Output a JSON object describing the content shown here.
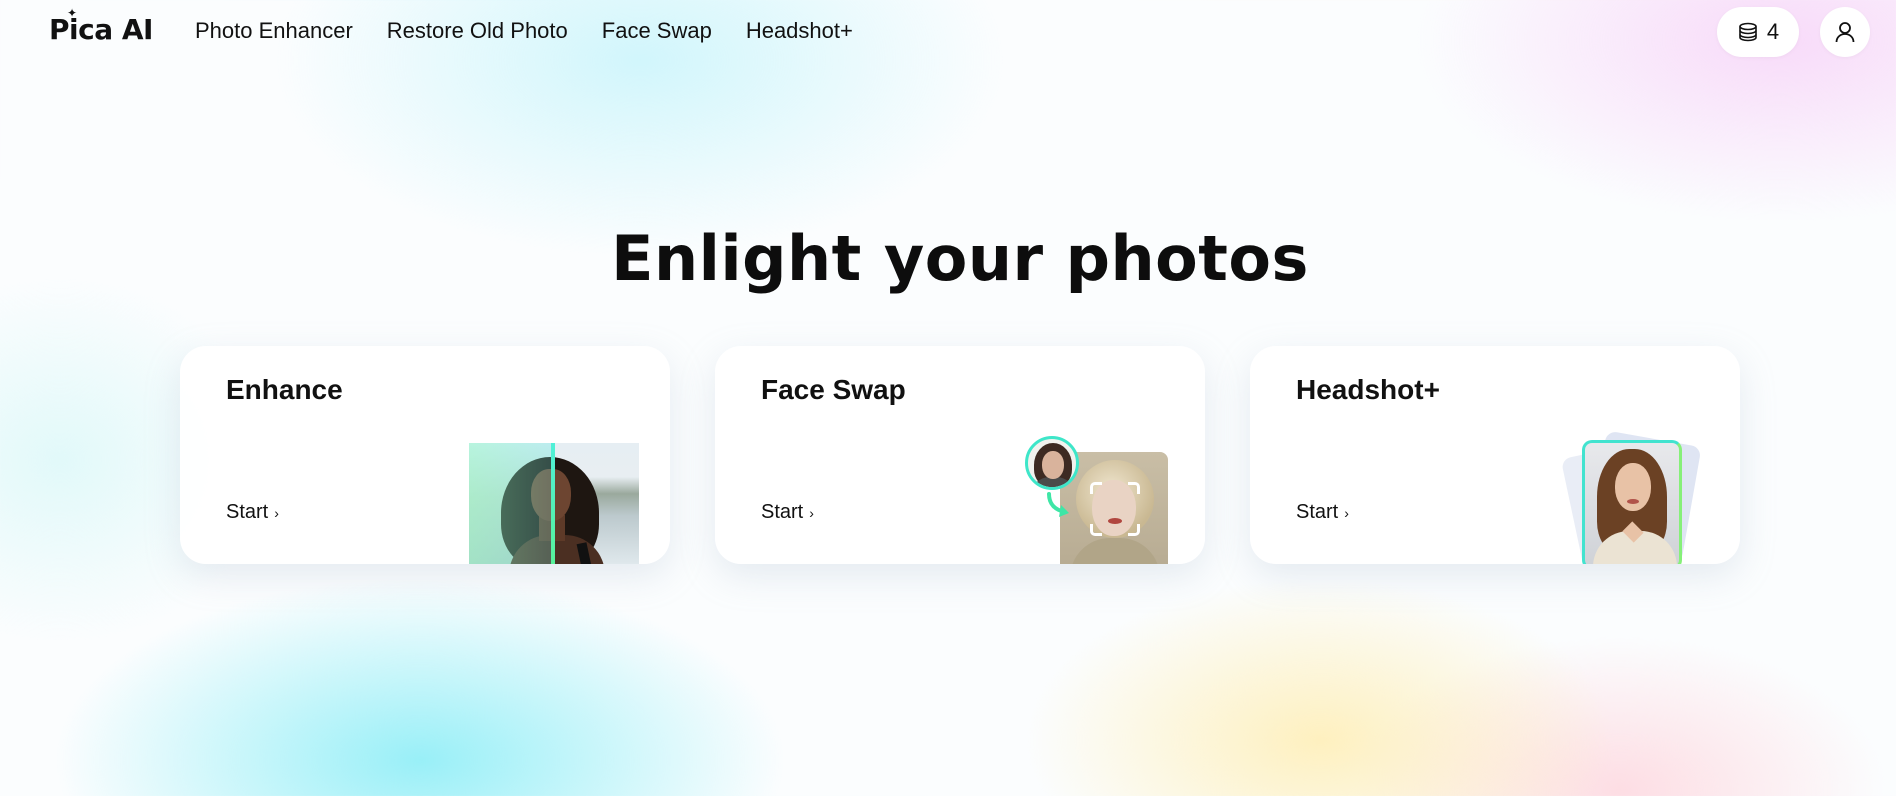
{
  "header": {
    "logo": "Pica AI",
    "nav": [
      "Photo Enhancer",
      "Restore Old Photo",
      "Face Swap",
      "Headshot+"
    ],
    "credits": "4"
  },
  "hero": {
    "title": "Enlight your photos"
  },
  "cards": [
    {
      "title": "Enhance",
      "start": "Start"
    },
    {
      "title": "Face Swap",
      "start": "Start"
    },
    {
      "title": "Headshot+",
      "start": "Start"
    }
  ],
  "colors": {
    "accent_teal": "#3ee6c9",
    "accent_green": "#57f29a",
    "text": "#111111",
    "card_bg": "#ffffff"
  },
  "icons": {
    "credits": "coins-stack-icon",
    "user": "user-icon",
    "start": "chevron-right-icon"
  }
}
